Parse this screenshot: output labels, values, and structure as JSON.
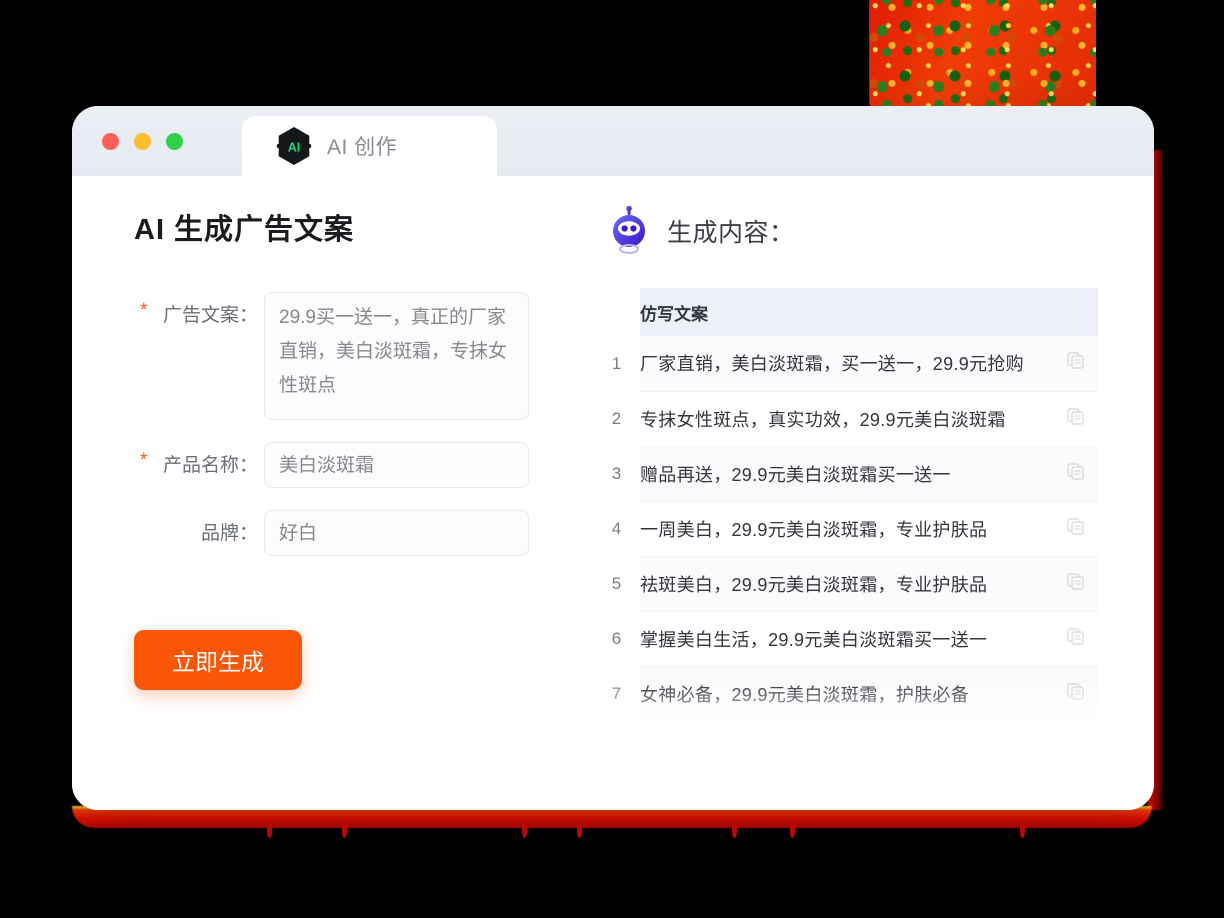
{
  "window": {
    "traffic_lights": [
      "close",
      "minimize",
      "maximize"
    ],
    "tab_label": "AI 创作",
    "logo_text": "AI"
  },
  "left_panel": {
    "title": "AI 生成广告文案",
    "fields": [
      {
        "label": "广告文案：",
        "required": true,
        "type": "textarea",
        "value": "29.9买一送一，真正的厂家直销，美白淡斑霜，专抹女性斑点",
        "placeholder": "请输入广告文案"
      },
      {
        "label": "产品名称：",
        "required": true,
        "type": "input",
        "value": "美白淡斑霜",
        "placeholder": "请输入产品名称"
      },
      {
        "label": "品牌：",
        "required": false,
        "type": "input",
        "value": "好白",
        "placeholder": "请输入品牌"
      }
    ],
    "submit_label": "立即生成",
    "submit_color": "#fb5607",
    "required_star_color": "#ff5a1f"
  },
  "right_panel": {
    "title": "生成内容：",
    "robot_icon": "robot-icon",
    "table": {
      "header": "仿写文案",
      "header_bg": "#eef0f7",
      "rows": [
        {
          "index": "1",
          "text": "厂家直销，美白淡斑霜，买一送一，29.9元抢购",
          "action": "copy-icon"
        },
        {
          "index": "2",
          "text": "专抹女性斑点，真实功效，29.9元美白淡斑霜",
          "action": "copy-icon"
        },
        {
          "index": "3",
          "text": "赠品再送，29.9元美白淡斑霜买一送一",
          "action": "copy-icon"
        },
        {
          "index": "4",
          "text": "一周美白，29.9元美白淡斑霜，专业护肤品",
          "action": "copy-icon"
        },
        {
          "index": "5",
          "text": "祛斑美白，29.9元美白淡斑霜，专业护肤品",
          "action": "copy-icon"
        },
        {
          "index": "6",
          "text": "掌握美白生活，29.9元美白淡斑霜买一送一",
          "action": "copy-icon"
        },
        {
          "index": "7",
          "text": "女神必备，29.9元美白淡斑霜，护肤必备",
          "action": "copy-icon"
        }
      ]
    }
  },
  "decor": {
    "accent_red": "#e40d03",
    "accent_orange": "#f03d06",
    "card_bg": "#ffffff",
    "titlebar_bg": "#eceef5"
  }
}
